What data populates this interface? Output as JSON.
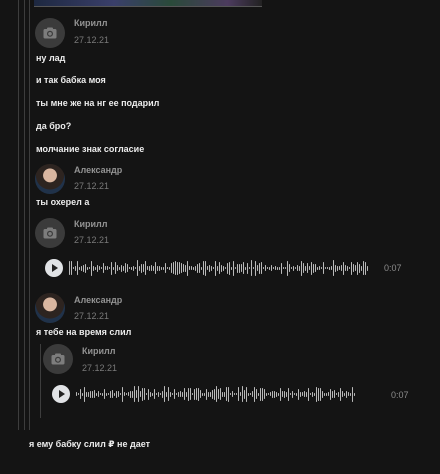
{
  "top_media": {
    "icon": "image-preview"
  },
  "messages": [
    {
      "author": "Кирилл",
      "date": "27.12.21",
      "avatar": "camera-placeholder",
      "lines": [
        "ну лад",
        "и так бабка моя",
        "ты мне же на нг ее подарил",
        "да бро?",
        "молчание знак согласие"
      ]
    },
    {
      "author": "Александр",
      "date": "27.12.21",
      "avatar": "photo",
      "lines": [
        "ты охерел а"
      ]
    },
    {
      "author": "Кирилл",
      "date": "27.12.21",
      "avatar": "camera-placeholder",
      "voice": {
        "duration": "0:07"
      }
    },
    {
      "author": "Александр",
      "date": "27.12.21",
      "avatar": "photo",
      "lines": [
        "я тебе на время слил"
      ],
      "quoted": {
        "author": "Кирилл",
        "date": "27.12.21",
        "voice": {
          "duration": "0:07"
        }
      }
    }
  ],
  "footer_message": "я ему бабку слил ₽ не дает",
  "colors": {
    "background": "#141414",
    "text": "#ececec",
    "name": "#939393",
    "date": "#7a7a7a",
    "thread_line": "#3d3d3d"
  }
}
